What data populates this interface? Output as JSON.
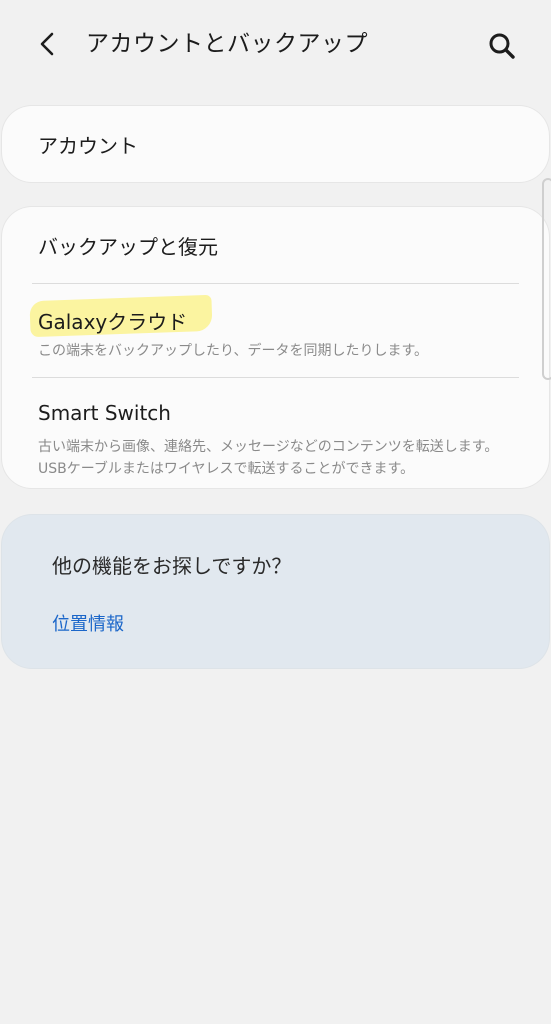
{
  "header": {
    "back_icon": "chevron-left-icon",
    "title": "アカウントとバックアップ",
    "search_icon": "search-icon"
  },
  "account_card": {
    "title": "アカウント"
  },
  "backup_card": {
    "items": [
      {
        "title": "バックアップと復元",
        "subtitle": ""
      },
      {
        "title": "Galaxyクラウド",
        "subtitle": "この端末をバックアップしたり、データを同期したりします。"
      },
      {
        "title": "Smart Switch",
        "subtitle": "古い端末から画像、連絡先、メッセージなどのコンテンツを転送します。USBケーブルまたはワイヤレスで転送することができます。"
      }
    ],
    "highlight_color": "#fbf4a0"
  },
  "other_card": {
    "title": "他の機能をお探しですか？",
    "link": "位置情報",
    "link_color": "#1b66c9",
    "background": "#e1e8ef"
  }
}
